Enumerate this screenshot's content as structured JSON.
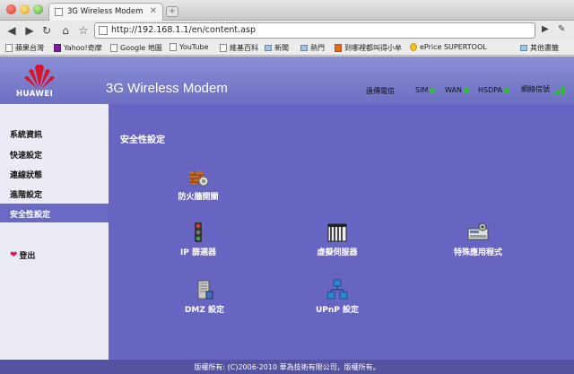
{
  "browser": {
    "tab_title": "3G Wireless Modem",
    "url": "http://192.168.1.1/en/content.asp",
    "bookmarks": [
      "蘋果台灣",
      "Yahoo!奇摩",
      "Google 地圖",
      "YouTube",
      "維基百科",
      "新聞",
      "熱門",
      "到哪裡都叫得小牟",
      "ePrice SUPERTOOL"
    ],
    "other_bookmarks": "其他書籤"
  },
  "header": {
    "logo_text": "HUAWEI",
    "product": "3G Wireless Modem",
    "carrier": "遠傳電信",
    "sim": "SIM",
    "wan": "WAN",
    "hsdpa": "HSDPA",
    "signal_label": "網絡信號",
    "signal_color": "#2ec12e",
    "signal_level": 5
  },
  "sidebar": {
    "items": [
      "系統資訊",
      "快速設定",
      "連線狀態",
      "進階設定"
    ],
    "active": "安全性設定",
    "logout": "登出"
  },
  "main": {
    "title": "安全性設定",
    "features": [
      "防火牆開關",
      "IP 篩選器",
      "虛擬伺服器",
      "特殊應用程式",
      "DMZ 設定",
      "UPnP 設定"
    ]
  },
  "footer": {
    "copyright": "版權所有: (C)2006-2010 華為技術有限公司，版權所有。"
  },
  "colors": {
    "accent": "#6765c1",
    "header": "#7d7fcc",
    "sidebar_bg": "#ebebf6",
    "footer": "#55539f"
  }
}
